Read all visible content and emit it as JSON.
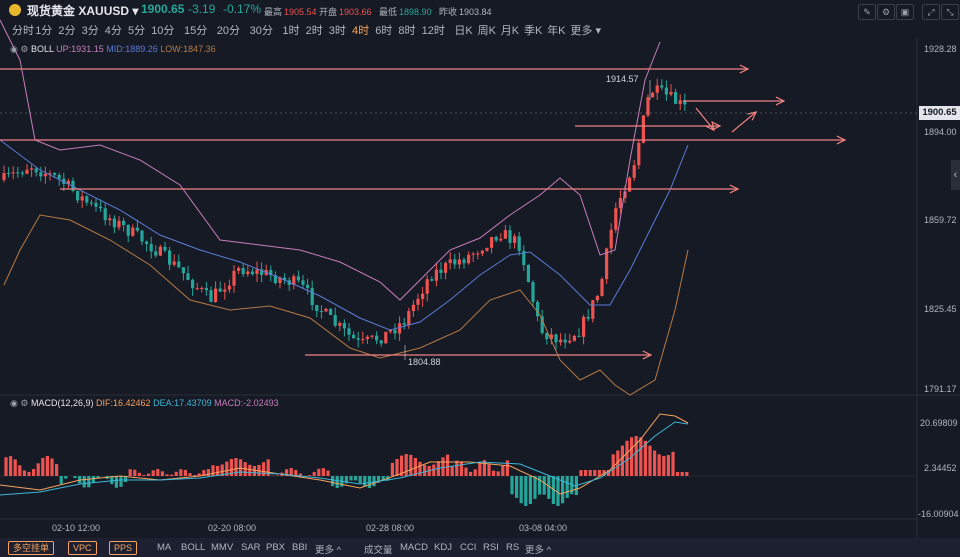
{
  "header": {
    "symbol_name": "现货黄金",
    "symbol_code": "XAUUSD",
    "price": "1900.65",
    "change": "-3.19",
    "change_pct": "-0.17%",
    "high_label": "最高",
    "high": "1905.54",
    "open_label": "开盘",
    "open": "1903.66",
    "low_label": "最低",
    "low": "1898.90",
    "prev_label": "昨收",
    "prev": "1903.84"
  },
  "periods": [
    "分时",
    "1分",
    "2分",
    "3分",
    "4分",
    "5分",
    "10分",
    "15分",
    "20分",
    "30分",
    "1时",
    "2时",
    "3时",
    "4时",
    "6时",
    "8时",
    "12时",
    "日K",
    "周K",
    "月K",
    "季K",
    "年K",
    "更多"
  ],
  "active_period": "4时",
  "boll": {
    "name": "BOLL",
    "up": "UP:1931.15",
    "mid": "MID:1889.26",
    "low": "LOW:1847.36"
  },
  "macd": {
    "name": "MACD(12,26,9)",
    "dif": "DIF:16.42462",
    "dea": "DEA:17.43709",
    "macd": "MACD:-2.02493"
  },
  "price_axis": [
    "1928.28",
    "1894.00",
    "1859.72",
    "1825.45",
    "1791.17"
  ],
  "current_price_tag": "1900.65",
  "macd_axis": [
    "20.69809",
    "2.34452",
    "-16.00904"
  ],
  "time_axis": [
    "02-10 12:00",
    "02-20 08:00",
    "02-28 08:00",
    "03-08 04:00"
  ],
  "annotations": {
    "high_mark": "1914.57",
    "low_mark": "1804.88"
  },
  "bottom_boxes": [
    "多空挂单",
    "VPC",
    "PPS"
  ],
  "bottom_main_tabs": [
    "MA",
    "BOLL",
    "MMV",
    "SAR",
    "PBX",
    "BBI",
    "更多"
  ],
  "bottom_sub_tabs": [
    "成交量",
    "MACD",
    "KDJ",
    "CCI",
    "RSI",
    "RS",
    "更多"
  ],
  "colors": {
    "up": "#ef5350",
    "down": "#26a69a",
    "boll_up": "#c77dba",
    "boll_mid": "#5b7bd5",
    "boll_low": "#b57a45",
    "arrow": "#f08080",
    "dif": "#f7a35c",
    "dea": "#3fb6d6"
  }
}
